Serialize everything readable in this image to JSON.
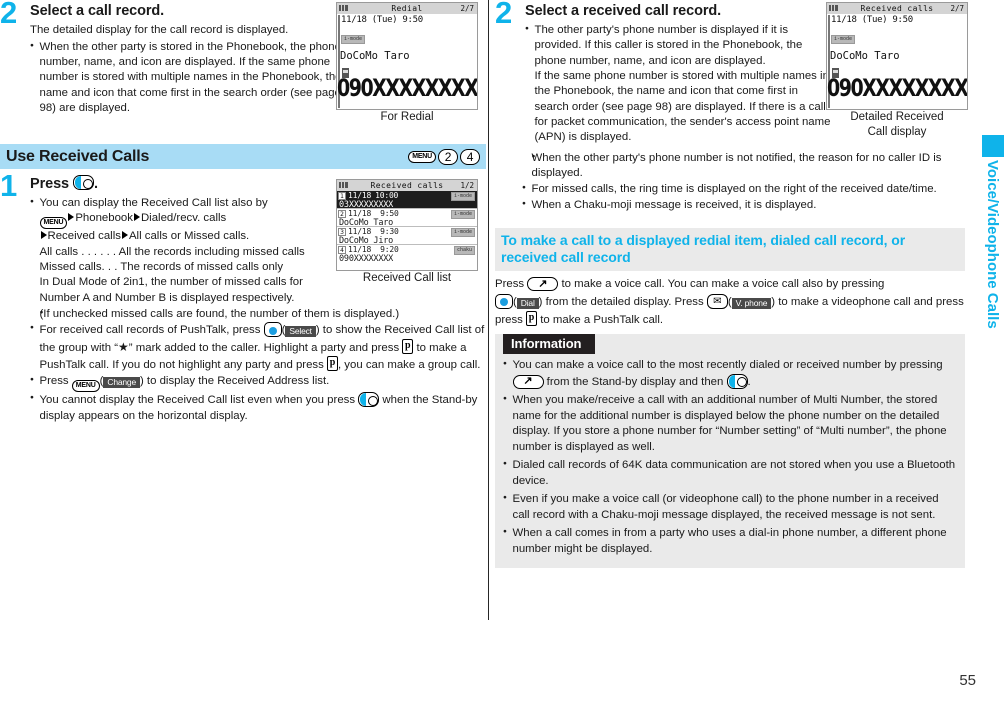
{
  "page": {
    "number": "55",
    "side_tab_label": "Voice/Videophone Calls"
  },
  "left_column": {
    "step2": {
      "number": "2",
      "title": "Select a call record.",
      "intro": "The detailed display for the call record is displayed.",
      "bullets": [
        "When the other party is stored in the Phonebook, the phone number, name, and icon are displayed. If the same phone number is stored with multiple names in the Phonebook, the name and icon that come first in the search order (see page 98) are displayed."
      ],
      "figure": {
        "caption": "For Redial",
        "status_title": "Redial",
        "page_counter": "2/7",
        "date_line": "11/18 (Tue)  9:50",
        "mini_icon": "docomo-tag",
        "name": "DoCoMo Taro",
        "number": "090XXXXXXXX"
      }
    },
    "section": {
      "title": "Use Received Calls",
      "keys": [
        "MENU",
        "2",
        "4"
      ]
    },
    "step1": {
      "number": "1",
      "title_prefix": "Press",
      "title_suffix": ".",
      "title_key": "nav-key-icon",
      "bullets": [
        {
          "lines": [
            "You can display the Received Call list also by",
            "MENU▶Phonebook▶Dialed/recv. calls",
            "▶Received calls▶All calls or Missed calls.",
            "All calls  . . . . . . All the records including missed calls",
            "Missed calls. . .  The records of missed calls only",
            "In Dual Mode of 2in1, the number of missed calls for",
            "Number A and Number B is displayed respectively.",
            "(If unchecked missed calls are found, the number of them is displayed.)"
          ]
        },
        {
          "text": "For received call records of PushTalk, press ●(Select) to show the Received Call list of the group with “★” mark added to the caller. Highlight a party and press p to make a PushTalk call. If you do not highlight any party and press p, you can make a group call."
        },
        {
          "text": "Press MENU(Change) to display the Received Address list."
        },
        {
          "text": "You cannot display the Received Call list even when you press ● when the Stand-by display appears on the horizontal display."
        }
      ],
      "figure": {
        "caption": "Received Call list",
        "status_title": "Received calls",
        "page_counter": "1/2",
        "rows": [
          {
            "index": "1",
            "date": "11/18",
            "time": "10:00",
            "second": "03XXXXXXXXX",
            "tag": "docomo",
            "selected": true
          },
          {
            "index": "2",
            "date": "11/18",
            "time": "9:50",
            "second": "DoCoMo Taro",
            "tag": "docomo",
            "selected": false
          },
          {
            "index": "3",
            "date": "11/18",
            "time": "9:30",
            "second": "DoCoMo Jiro",
            "tag": "docomo",
            "selected": false
          },
          {
            "index": "4",
            "date": "11/18",
            "time": "9:20",
            "second": "090XXXXXXXX",
            "tag": "mail",
            "selected": false
          }
        ]
      }
    }
  },
  "right_column": {
    "step2": {
      "number": "2",
      "title": "Select a received call record.",
      "bullets": [
        {
          "lines": [
            "The other party's phone number is displayed if it is provided. If this caller is stored in the Phonebook, the phone number, name, and icon are displayed.",
            "If the same phone number is stored with multiple names in the Phonebook, the name and icon that come first in search order (see page 98) are displayed. If there is a call for packet communication, the sender's access point name (APN) is displayed.",
            "When the other party's phone number is not notified, the reason for no caller ID is displayed."
          ]
        },
        {
          "text": "For missed calls, the ring time is displayed on the right of the received date/time."
        },
        {
          "text": "When a Chaku-moji message is received, it is displayed."
        }
      ],
      "figure": {
        "caption_line1": "Detailed Received",
        "caption_line2": "Call display",
        "status_title": "Received calls",
        "page_counter": "2/7",
        "date_line": "11/18 (Tue)  9:50",
        "name": "DoCoMo Taro",
        "number": "090XXXXXXXX"
      }
    },
    "subsection": {
      "heading": "To make a call to a displayed redial item, dialed call record, or received call record",
      "paragraph_part1": "Press",
      "paragraph_part2": "to make a voice call. You can make a voice call also by pressing",
      "paragraph_part3": "(",
      "paragraph_softkey1": "Dial",
      "paragraph_part4": ") from the detailed display. Press",
      "paragraph_part5": "(",
      "paragraph_softkey2": "V. phone",
      "paragraph_part6": ") to make a videophone call and press",
      "paragraph_part7": "to make a PushTalk call."
    },
    "information": {
      "label": "Information",
      "bullets": [
        {
          "segments": [
            "You can make a voice call to the most recently dialed or received number by pressing",
            "from the Stand-by display and then",
            "."
          ]
        },
        {
          "text": "When you make/receive a call with an additional number of Multi Number, the stored name for the additional number is displayed below the phone number on the detailed display. If you store a phone number for “Number setting” of “Multi number”, the phone number is displayed as well."
        },
        {
          "text": "Dialed call records of 64K data communication are not stored when you use a Bluetooth device."
        },
        {
          "text": "Even if you make a voice call (or videophone call) to the phone number in a received call record with a Chaku-moji message displayed, the received message is not sent."
        },
        {
          "text": "When a call comes in from a party who uses a dial-in phone number, a different phone number might be displayed."
        }
      ]
    }
  },
  "colors": {
    "accent_cyan": "#0fb3ea",
    "section_bar_blue": "#a8dcf5",
    "panel_grey": "#eaeaea",
    "label_black": "#231f20"
  }
}
